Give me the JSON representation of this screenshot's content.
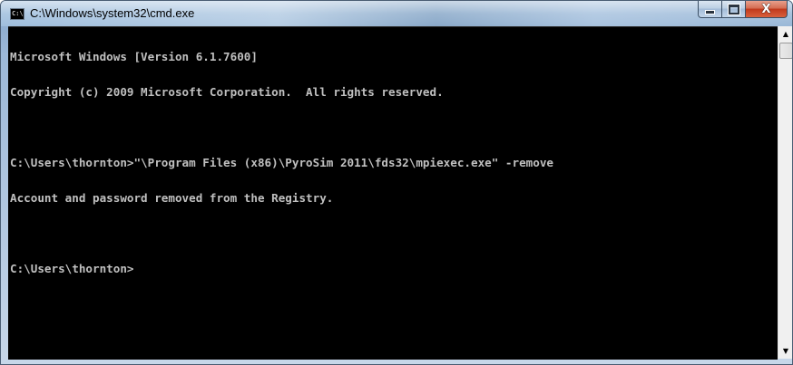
{
  "window": {
    "title": "C:\\Windows\\system32\\cmd.exe",
    "icon_label": "C:\\",
    "icon": "cmd-icon"
  },
  "caption_buttons": {
    "minimize_icon": "minimize-icon",
    "maximize_icon": "maximize-icon",
    "close_glyph": "X",
    "close_color": "#c1391c"
  },
  "console": {
    "text_color": "#c0c0c0",
    "background": "#000000",
    "lines": [
      "Microsoft Windows [Version 6.1.7600]",
      "Copyright (c) 2009 Microsoft Corporation.  All rights reserved.",
      "",
      "C:\\Users\\thornton>\"\\Program Files (x86)\\PyroSim 2011\\fds32\\mpiexec.exe\" -remove",
      "Account and password removed from the Registry.",
      "",
      "C:\\Users\\thornton>"
    ]
  },
  "scrollbar": {
    "up_glyph": "▲",
    "down_glyph": "▼"
  }
}
